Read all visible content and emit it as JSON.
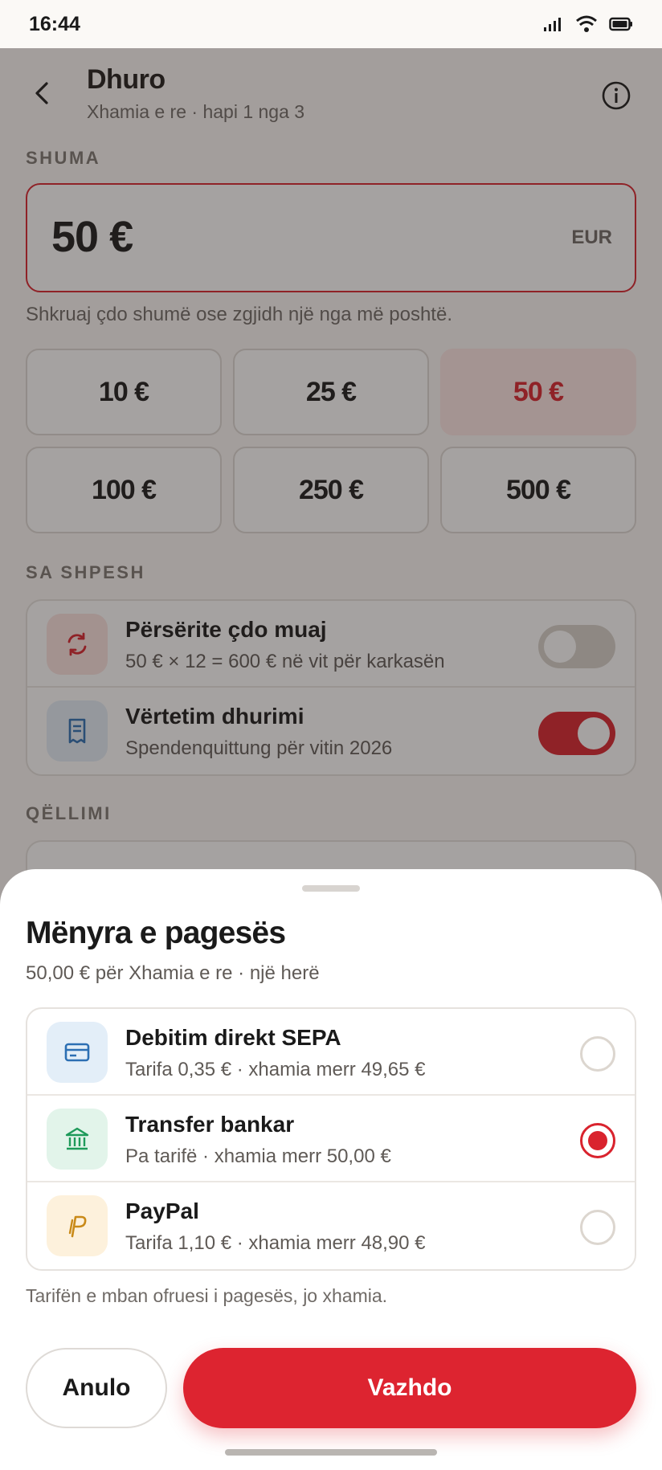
{
  "status_bar": {
    "time": "16:44"
  },
  "header": {
    "title": "Dhuro",
    "subtitle": "Xhamia e re · hapi 1 nga 3"
  },
  "amount": {
    "section_label": "SHUMA",
    "value": "50 €",
    "currency": "EUR",
    "hint": "Shkruaj çdo shumë ose zgjidh një nga më poshtë.",
    "presets": [
      {
        "label": "10 €",
        "selected": false
      },
      {
        "label": "25 €",
        "selected": false
      },
      {
        "label": "50 €",
        "selected": true
      },
      {
        "label": "100 €",
        "selected": false
      },
      {
        "label": "250 €",
        "selected": false
      },
      {
        "label": "500 €",
        "selected": false
      }
    ]
  },
  "frequency": {
    "section_label": "SA SHPESH",
    "rows": [
      {
        "title": "Përsërite çdo muaj",
        "subtitle": "50 € × 12 = 600 € në vit për karkasën",
        "toggle_on": false,
        "icon": "repeat-icon"
      },
      {
        "title": "Vërtetim dhurimi",
        "subtitle": "Spendenquittung për vitin 2026",
        "toggle_on": true,
        "icon": "receipt-icon"
      }
    ]
  },
  "purpose": {
    "section_label": "QËLLIMI"
  },
  "payment_sheet": {
    "title": "Mënyra e pagesës",
    "subtitle": "50,00 € për Xhamia e re · një herë",
    "methods": [
      {
        "title": "Debitim direkt SEPA",
        "subtitle": "Tarifa 0,35 € · xhamia merr 49,65 €",
        "selected": false,
        "icon": "card-icon"
      },
      {
        "title": "Transfer bankar",
        "subtitle": "Pa tarifë · xhamia merr 50,00 €",
        "selected": true,
        "icon": "bank-icon"
      },
      {
        "title": "PayPal",
        "subtitle": "Tarifa 1,10 € · xhamia merr 48,90 €",
        "selected": false,
        "icon": "paypal-icon"
      }
    ],
    "footnote": "Tarifën e mban ofruesi i pagesës, jo xhamia.",
    "cancel_label": "Anulo",
    "continue_label": "Vazhdo"
  },
  "colors": {
    "accent": "#dd2430",
    "selected_chip_bg": "#fde7e5",
    "repeat_icon_bg": "#fbe3e1",
    "receipt_icon_bg": "#e3eef8",
    "card_icon_bg": "#e3eef8",
    "bank_icon_bg": "#e2f4ea",
    "paypal_icon_bg": "#fdf1dc"
  }
}
